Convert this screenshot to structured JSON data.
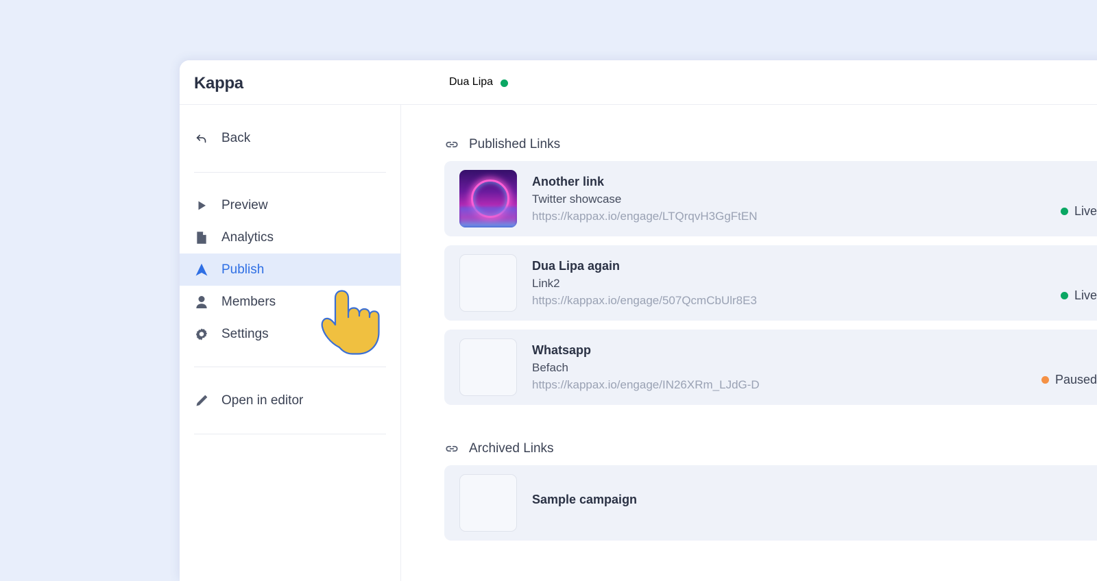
{
  "app": {
    "brand": "Kappa"
  },
  "header": {
    "project_name": "Dua Lipa",
    "status_color": "#0aa763"
  },
  "sidebar": {
    "back": {
      "label": "Back",
      "icon": "back-arrow-icon"
    },
    "items": [
      {
        "label": "Preview",
        "icon": "play-icon",
        "active": false
      },
      {
        "label": "Analytics",
        "icon": "document-icon",
        "active": false
      },
      {
        "label": "Publish",
        "icon": "send-icon",
        "active": true
      },
      {
        "label": "Members",
        "icon": "person-icon",
        "active": false
      },
      {
        "label": "Settings",
        "icon": "gear-icon",
        "active": false
      }
    ],
    "editor": {
      "label": "Open in editor",
      "icon": "pencil-icon"
    },
    "active_color": "#2f6fe4",
    "active_bg": "#e3ebfb"
  },
  "main": {
    "sections": [
      {
        "title": "Published Links",
        "icon": "link-icon",
        "cards": [
          {
            "title": "Another link",
            "subtitle": "Twitter showcase",
            "url": "https://kappax.io/engage/LTQrqvH3GgFtEN",
            "status": "Live",
            "status_color": "#0aa763",
            "thumb": "neon-circle-image"
          },
          {
            "title": "Dua Lipa again",
            "subtitle": "Link2",
            "url": "https://kappax.io/engage/507QcmCbUlr8E3",
            "status": "Live",
            "status_color": "#0aa763",
            "thumb": "empty-thumbnail"
          },
          {
            "title": "Whatsapp",
            "subtitle": "Befach",
            "url": "https://kappax.io/engage/IN26XRm_LJdG-D",
            "status": "Paused",
            "status_color": "#f59145",
            "thumb": "empty-thumbnail"
          }
        ]
      },
      {
        "title": "Archived Links",
        "icon": "link-icon",
        "cards": [
          {
            "title": "Sample campaign",
            "subtitle": "",
            "url": "",
            "status": "",
            "status_color": "#9aa2b4",
            "thumb": "empty-thumbnail"
          }
        ]
      }
    ]
  },
  "cursor": {
    "type": "pointing-hand-cursor",
    "fill": "#f0c040",
    "stroke": "#3b6fd4"
  }
}
